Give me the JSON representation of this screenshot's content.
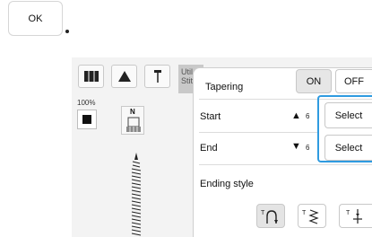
{
  "ok_key": {
    "label": "OK"
  },
  "sidebar": {
    "utility_tab": "Util Stit",
    "zoom": "100%",
    "presser_foot_letter": "N"
  },
  "panel": {
    "tapering": {
      "label": "Tapering",
      "on": "ON",
      "off": "OFF",
      "selected": "ON"
    },
    "start": {
      "label": "Start",
      "value": "6",
      "button": "Select"
    },
    "end": {
      "label": "End",
      "value": "6",
      "button": "Select"
    },
    "ending_style": {
      "label": "Ending style"
    }
  },
  "colors": {
    "highlight": "#2f9be0",
    "screen_bg": "#f3f3f3"
  },
  "icons": [
    "embroidery-book-icon",
    "cone-icon",
    "needle-icon",
    "presser-foot-icon",
    "stitch-preview-icon"
  ]
}
